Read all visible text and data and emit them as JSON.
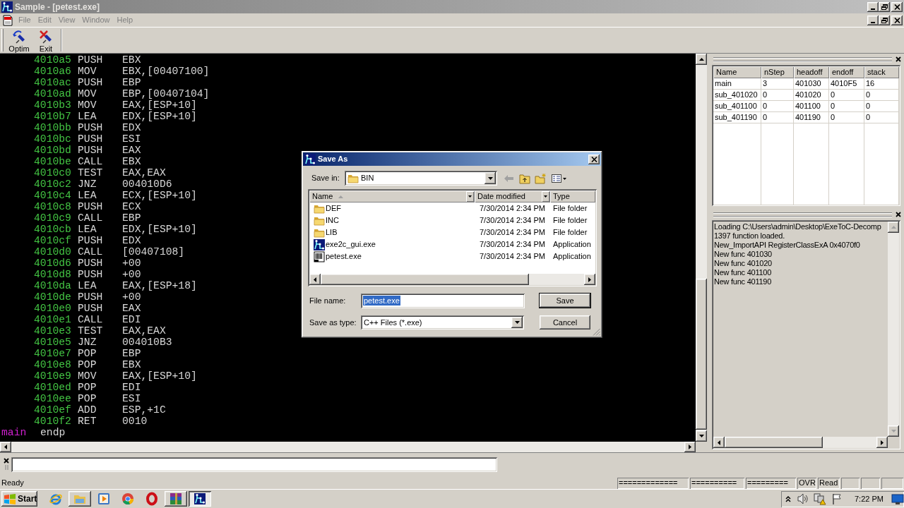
{
  "window": {
    "title": "Sample - [petest.exe]",
    "active": false
  },
  "menu": [
    {
      "label": "File",
      "disabled": true
    },
    {
      "label": "Edit",
      "disabled": true
    },
    {
      "label": "View",
      "disabled": true
    },
    {
      "label": "Window",
      "disabled": true
    },
    {
      "label": "Help",
      "disabled": true
    }
  ],
  "toolbar": [
    {
      "label": "Optim"
    },
    {
      "label": "Exit"
    }
  ],
  "code": {
    "lines": [
      {
        "address": "4010a5",
        "mnemonic": "PUSH",
        "operand": "EBX"
      },
      {
        "address": "4010a6",
        "mnemonic": "MOV",
        "operand": "EBX,[00407100]"
      },
      {
        "address": "4010ac",
        "mnemonic": "PUSH",
        "operand": "EBP"
      },
      {
        "address": "4010ad",
        "mnemonic": "MOV",
        "operand": "EBP,[00407104]"
      },
      {
        "address": "4010b3",
        "mnemonic": "MOV",
        "operand": "EAX,[ESP+10]"
      },
      {
        "address": "4010b7",
        "mnemonic": "LEA",
        "operand": "EDX,[ESP+10]"
      },
      {
        "address": "4010bb",
        "mnemonic": "PUSH",
        "operand": "EDX"
      },
      {
        "address": "4010bc",
        "mnemonic": "PUSH",
        "operand": "ESI"
      },
      {
        "address": "4010bd",
        "mnemonic": "PUSH",
        "operand": "EAX"
      },
      {
        "address": "4010be",
        "mnemonic": "CALL",
        "operand": "EBX"
      },
      {
        "address": "4010c0",
        "mnemonic": "TEST",
        "operand": "EAX,EAX"
      },
      {
        "address": "4010c2",
        "mnemonic": "JNZ",
        "operand": "004010D6"
      },
      {
        "address": "4010c4",
        "mnemonic": "LEA",
        "operand": "ECX,[ESP+10]"
      },
      {
        "address": "4010c8",
        "mnemonic": "PUSH",
        "operand": "ECX"
      },
      {
        "address": "4010c9",
        "mnemonic": "CALL",
        "operand": "EBP"
      },
      {
        "address": "4010cb",
        "mnemonic": "LEA",
        "operand": "EDX,[ESP+10]"
      },
      {
        "address": "4010cf",
        "mnemonic": "PUSH",
        "operand": "EDX"
      },
      {
        "address": "4010d0",
        "mnemonic": "CALL",
        "operand": "[00407108]"
      },
      {
        "address": "4010d6",
        "mnemonic": "PUSH",
        "operand": "+00"
      },
      {
        "address": "4010d8",
        "mnemonic": "PUSH",
        "operand": "+00"
      },
      {
        "address": "4010da",
        "mnemonic": "LEA",
        "operand": "EAX,[ESP+18]"
      },
      {
        "address": "4010de",
        "mnemonic": "PUSH",
        "operand": "+00"
      },
      {
        "address": "4010e0",
        "mnemonic": "PUSH",
        "operand": "EAX"
      },
      {
        "address": "4010e1",
        "mnemonic": "CALL",
        "operand": "EDI"
      },
      {
        "address": "4010e3",
        "mnemonic": "TEST",
        "operand": "EAX,EAX"
      },
      {
        "address": "4010e5",
        "mnemonic": "JNZ",
        "operand": "004010B3"
      },
      {
        "address": "4010e7",
        "mnemonic": "POP",
        "operand": "EBP"
      },
      {
        "address": "4010e8",
        "mnemonic": "POP",
        "operand": "EBX"
      },
      {
        "address": "4010e9",
        "mnemonic": "MOV",
        "operand": "EAX,[ESP+10]"
      },
      {
        "address": "4010ed",
        "mnemonic": "POP",
        "operand": "EDI"
      },
      {
        "address": "4010ee",
        "mnemonic": "POP",
        "operand": "ESI"
      },
      {
        "address": "4010ef",
        "mnemonic": "ADD",
        "operand": "ESP,+1C"
      },
      {
        "address": "4010f2",
        "mnemonic": "RET",
        "operand": "0010"
      }
    ],
    "end": {
      "name": "main",
      "keyword": "endp"
    }
  },
  "functions": {
    "columns": [
      "Name",
      "nStep",
      "headoff",
      "endoff",
      "stack"
    ],
    "rows": [
      [
        "main",
        "3",
        "401030",
        "4010F5",
        "16"
      ],
      [
        "sub_401020",
        "0",
        "401020",
        "0",
        "0"
      ],
      [
        "sub_401100",
        "0",
        "401100",
        "0",
        "0"
      ],
      [
        "sub_401190",
        "0",
        "401190",
        "0",
        "0"
      ]
    ]
  },
  "log": [
    "Loading C:\\Users\\admin\\Desktop\\ExeToC-Decomp",
    "1397 function loaded.",
    "New_ImportAPI RegisterClassExA 0x4070f0",
    "New func 401030",
    "New func 401020",
    "New func 401100",
    "New func 401190"
  ],
  "status_bar": {
    "text": "Ready",
    "panes": [
      "=============",
      "==========",
      "=========",
      "OVR",
      "Read"
    ]
  },
  "taskbar": {
    "start": "Start",
    "apps": [
      {
        "open": false,
        "selected": false
      },
      {
        "open": true,
        "selected": false
      },
      {
        "open": false,
        "selected": false
      },
      {
        "open": false,
        "selected": false
      },
      {
        "open": false,
        "selected": false
      },
      {
        "open": true,
        "selected": false
      },
      {
        "open": true,
        "selected": true
      }
    ],
    "clock": "7:22 PM"
  },
  "dialog": {
    "title": "Save As",
    "active": true,
    "save_in": {
      "label": "Save in:",
      "value": "BIN"
    },
    "nav": [
      {
        "disabled": true
      },
      {
        "disabled": false
      },
      {
        "disabled": false
      },
      {
        "disabled": false
      }
    ],
    "columns": [
      {
        "label": "Name",
        "sorted": true
      },
      {
        "label": "Date modified",
        "sorted": false
      },
      {
        "label": "Type",
        "sorted": false
      }
    ],
    "files": [
      {
        "kind": "folder",
        "name": "DEF",
        "date": "7/30/2014 2:34 PM",
        "type": "File folder"
      },
      {
        "kind": "folder",
        "name": "INC",
        "date": "7/30/2014 2:34 PM",
        "type": "File folder"
      },
      {
        "kind": "folder",
        "name": "LIB",
        "date": "7/30/2014 2:34 PM",
        "type": "File folder"
      },
      {
        "kind": "app",
        "name": "exe2c_gui.exe",
        "date": "7/30/2014 2:34 PM",
        "type": "Application"
      },
      {
        "kind": "exe",
        "name": "petest.exe",
        "date": "7/30/2014 2:34 PM",
        "type": "Application"
      }
    ],
    "file_name": {
      "label": "File name:",
      "value": "petest.exe",
      "selected": true
    },
    "file_type": {
      "label": "Save as type:",
      "value": "C++ Files (*.exe)"
    },
    "buttons": [
      {
        "label": "Save",
        "default": true
      },
      {
        "label": "Cancel",
        "default": false
      }
    ]
  }
}
